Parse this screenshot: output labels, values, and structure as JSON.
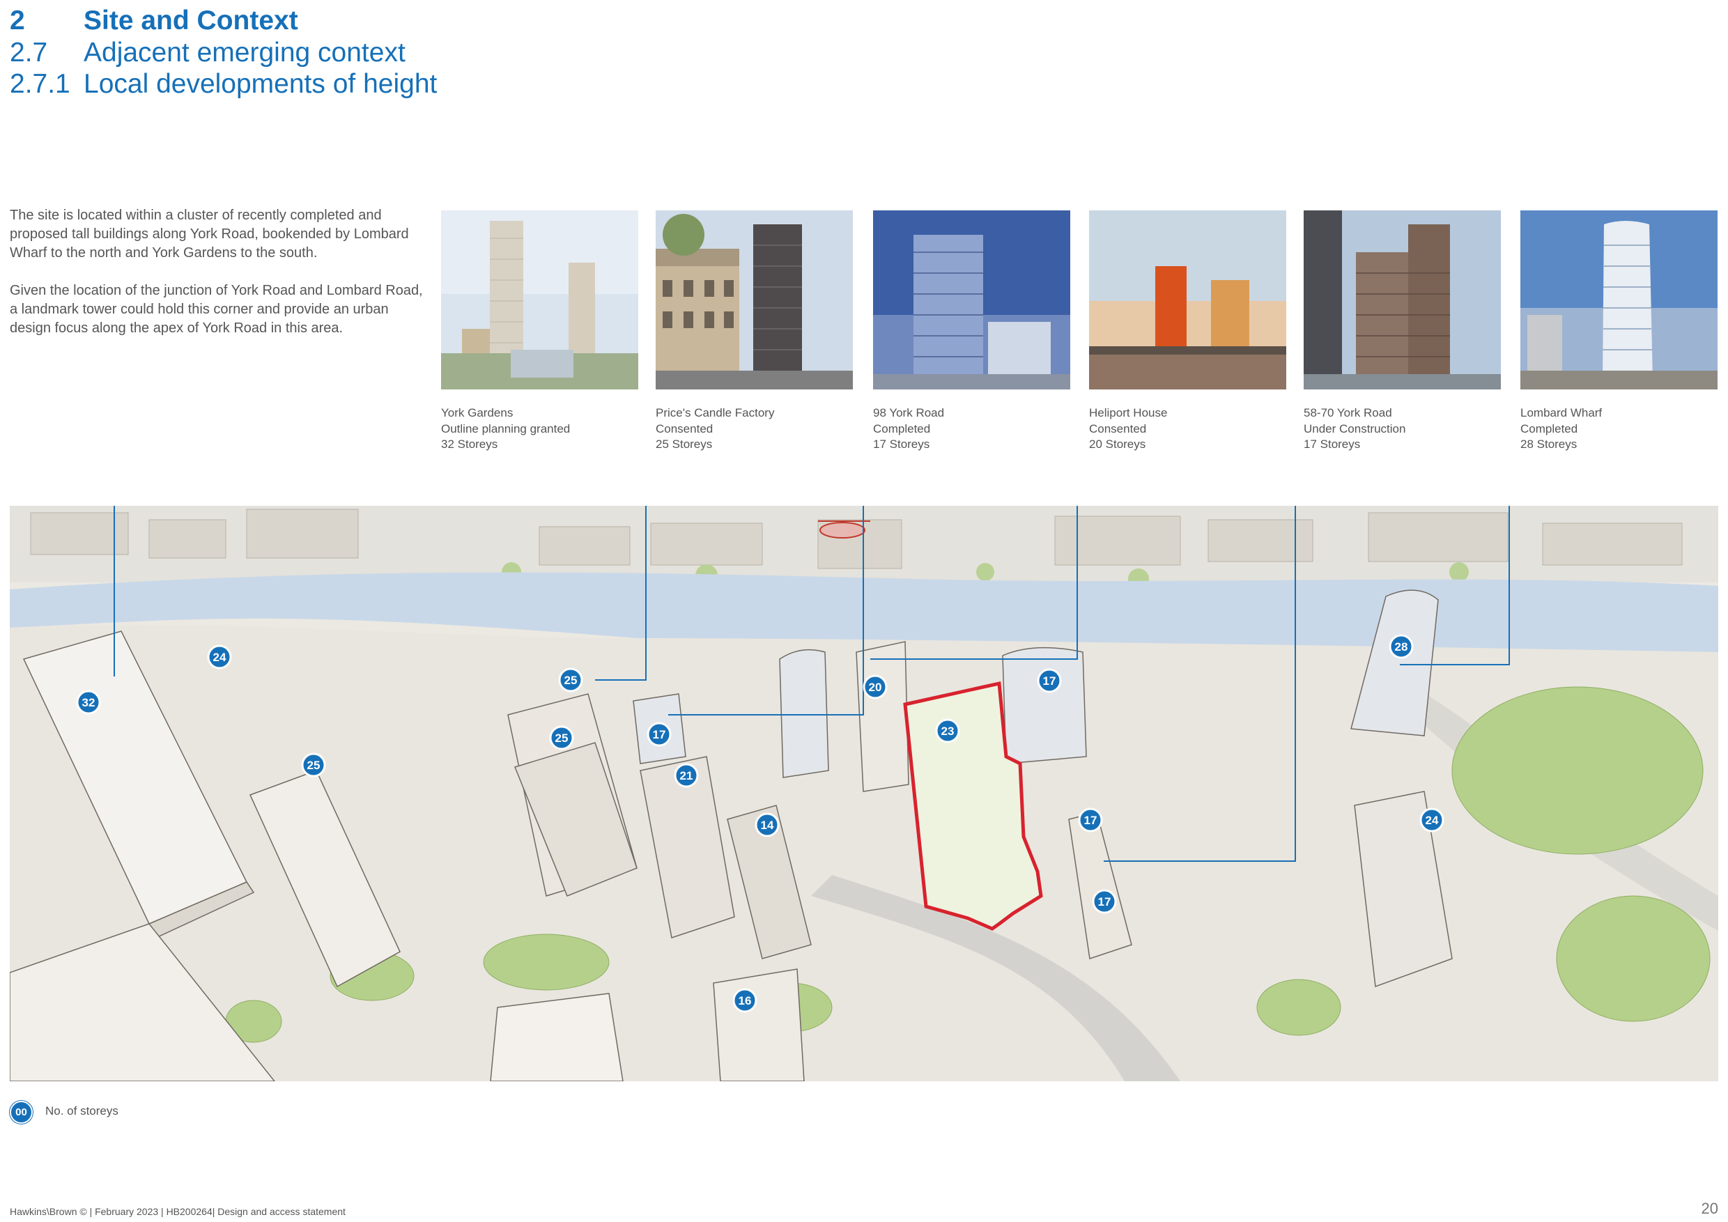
{
  "heading": {
    "section_number": "2",
    "section_title": "Site and Context",
    "subsection_number": "2.7",
    "subsection_title": "Adjacent emerging context",
    "subsubsection_number": "2.7.1",
    "subsubsection_title": "Local developments of height"
  },
  "intro": {
    "paragraph_1": "The site is located within a cluster of recently completed and proposed tall buildings along York Road, bookended by Lombard Wharf to the north and York Gardens to the south.",
    "paragraph_2": "Given the location of the junction of York Road and Lombard Road, a landmark tower could hold this corner and provide an urban design focus along the apex of York Road in this area."
  },
  "developments": [
    {
      "name": "York Gardens",
      "status": "Outline planning granted",
      "storeys": "32 Storeys"
    },
    {
      "name": "Price's Candle Factory",
      "status": "Consented",
      "storeys": "25 Storeys"
    },
    {
      "name": "98 York Road",
      "status": "Completed",
      "storeys": "17 Storeys"
    },
    {
      "name": "Heliport House",
      "status": "Consented",
      "storeys": "20 Storeys"
    },
    {
      "name": "58-70 York Road",
      "status": "Under Construction",
      "storeys": "17 Storeys"
    },
    {
      "name": "Lombard Wharf",
      "status": "Completed",
      "storeys": "28 Storeys"
    }
  ],
  "map_badges": [
    "32",
    "24",
    "25",
    "25",
    "25",
    "17",
    "21",
    "14",
    "20",
    "23",
    "17",
    "17",
    "17",
    "28",
    "24",
    "16"
  ],
  "legend": {
    "badge": "00",
    "label": "No. of storeys"
  },
  "footer": {
    "text": "Hawkins\\Brown © | February 2023 | HB200264| Design and access statement",
    "page_number": "20"
  },
  "colors": {
    "accent": "#1670b8",
    "site_outline": "#d7232e",
    "site_fill": "#eef3e0",
    "river": "#c9d8e8",
    "trees": "#b5d08a"
  }
}
